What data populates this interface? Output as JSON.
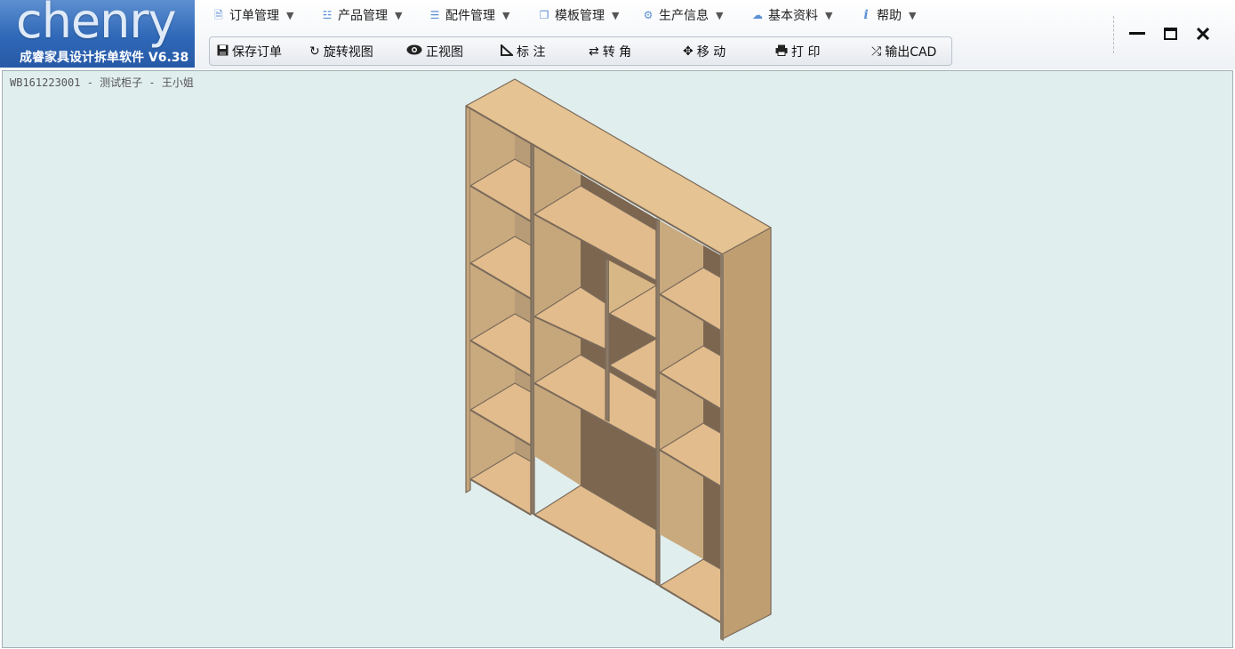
{
  "logo": {
    "wordmark": "chenry",
    "subtitle": "成睿家具设计拆单软件 V6.38"
  },
  "menu": [
    {
      "label": "订单管理",
      "icon": "document-icon"
    },
    {
      "label": "产品管理",
      "icon": "database-icon"
    },
    {
      "label": "配件管理",
      "icon": "list-icon"
    },
    {
      "label": "模板管理",
      "icon": "copy-icon"
    },
    {
      "label": "生产信息",
      "icon": "gear-icon"
    },
    {
      "label": "基本资料",
      "icon": "cloud-icon"
    },
    {
      "label": "帮助",
      "icon": "info-icon"
    }
  ],
  "toolbar": {
    "save": "保存订单",
    "rotate_view": "旋转视图",
    "front_view": "正视图",
    "annotate": "标 注",
    "turn_corner": "转 角",
    "move": "移 动",
    "print": "打 印",
    "export_cad": "输出CAD"
  },
  "viewport": {
    "caption": "WB161223001 - 测试柜子 - 王小姐"
  },
  "colors": {
    "accent": "#2f68b8",
    "canvas_bg": "#e1eeee",
    "wood_front": "#e2bc8c",
    "wood_side": "#bf9e72",
    "wood_edge": "#7a6a5a"
  }
}
